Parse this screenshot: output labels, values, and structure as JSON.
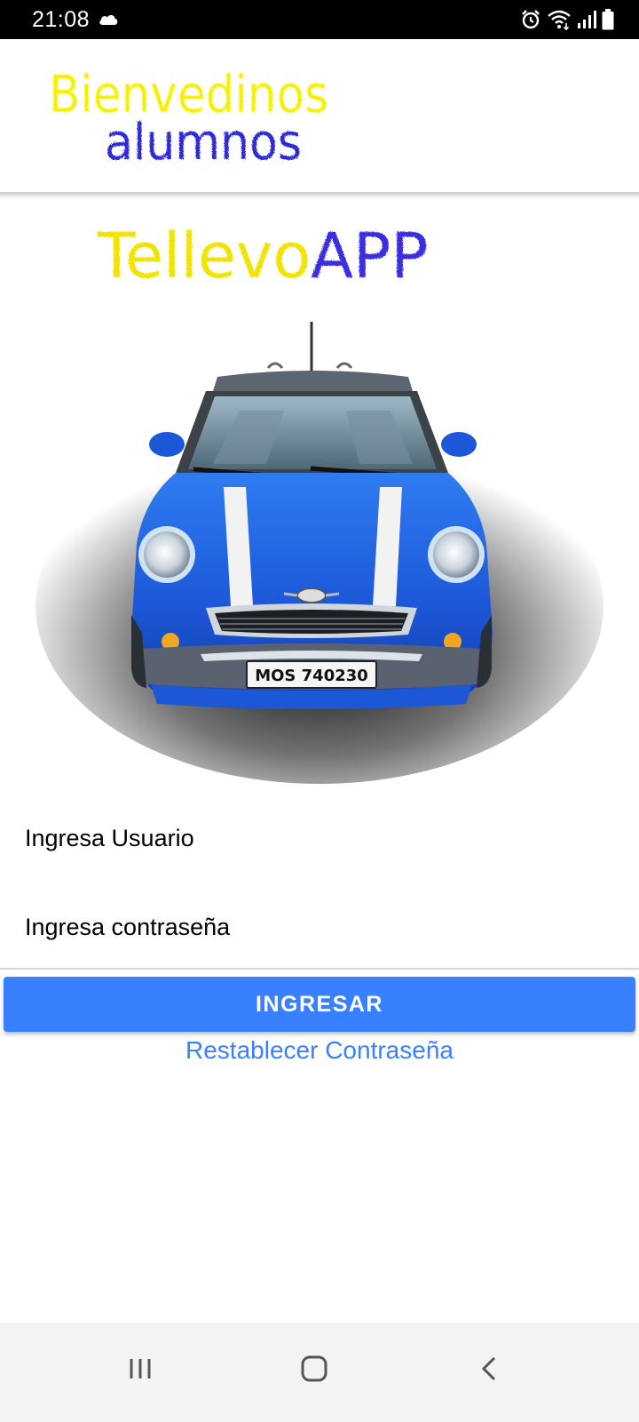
{
  "status_bar": {
    "time": "21:08",
    "icons": [
      "cloud-icon",
      "alarm-icon",
      "wifi-icon",
      "signal-icon",
      "battery-icon"
    ]
  },
  "header": {
    "title_line1": "Bienvedinos",
    "title_line2": "alumnos",
    "colors": {
      "line1": "#f5f000",
      "line2": "#2d2ad8"
    }
  },
  "logo": {
    "part1": "Tellevo",
    "part2": "APP",
    "colors": {
      "part1": "#f2e400",
      "part2": "#3b2fe0"
    }
  },
  "car": {
    "plate": "MOS 740230",
    "body_color": "#1f5fe0"
  },
  "form": {
    "username_placeholder": "Ingresa Usuario",
    "password_placeholder": "Ingresa contraseña",
    "login_label": "INGRESAR",
    "reset_label": "Restablecer Contraseña",
    "accent_color": "#3880ff"
  },
  "nav_bar": {
    "buttons": [
      "recents-icon",
      "home-icon",
      "back-icon"
    ]
  }
}
